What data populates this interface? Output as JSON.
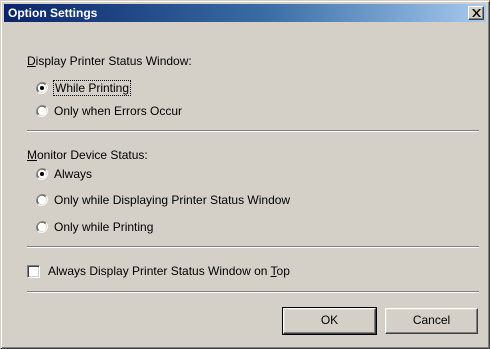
{
  "window": {
    "title": "Option Settings"
  },
  "display_status": {
    "label_mnemonic": "D",
    "label_rest": "isplay Printer Status Window:",
    "options": [
      {
        "label": "While Printing",
        "selected": true,
        "focused": true
      },
      {
        "label": "Only when Errors Occur",
        "selected": false,
        "focused": false
      }
    ]
  },
  "monitor_status": {
    "label_mnemonic": "M",
    "label_rest": "onitor Device Status:",
    "options": [
      {
        "label": "Always",
        "selected": true
      },
      {
        "label": "Only while Displaying Printer Status Window",
        "selected": false
      },
      {
        "label": "Only while Printing",
        "selected": false
      }
    ]
  },
  "always_on_top": {
    "label_before": "Always Display Printer Status Window on ",
    "label_mnemonic": "T",
    "label_after": "op",
    "checked": false
  },
  "buttons": {
    "ok": "OK",
    "cancel": "Cancel"
  },
  "icons": {
    "close": "close-icon",
    "radio_selected": "radio-selected-icon",
    "radio_unselected": "radio-unselected-icon"
  }
}
